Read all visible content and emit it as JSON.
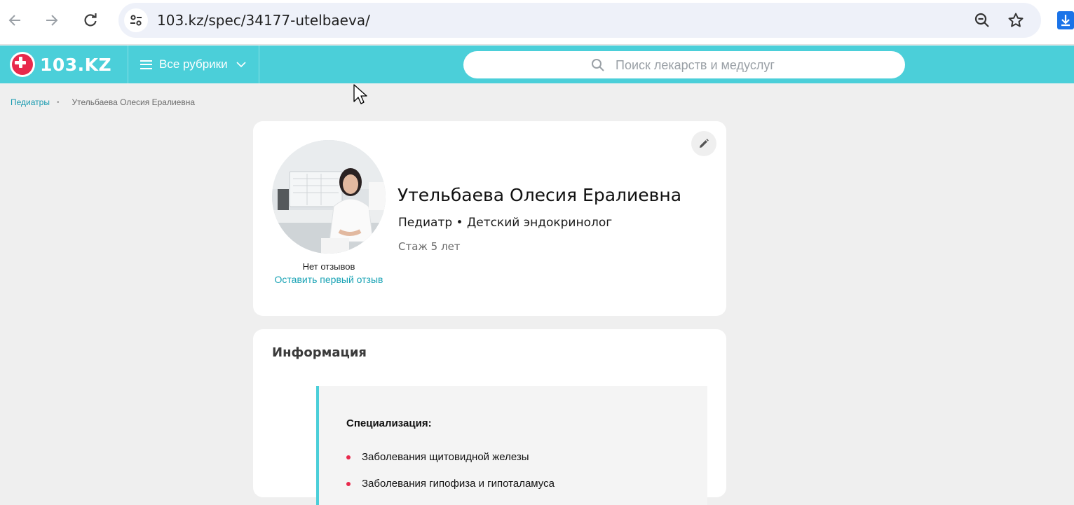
{
  "browser": {
    "url": "103.kz/spec/34177-utelbaeva/",
    "icons": {
      "back": "arrow-left-icon",
      "forward": "arrow-right-icon",
      "reload": "reload-icon",
      "site_info": "tune-icon",
      "zoom": "zoom-out-icon",
      "bookmark": "star-icon",
      "download": "download-icon"
    }
  },
  "header": {
    "logo_text": "103.KZ",
    "rubrics_label": "Все рубрики",
    "search_placeholder": "Поиск лекарств и медуслуг",
    "colors": {
      "header_bg": "#4bcfd9",
      "logo_red": "#e8294c"
    }
  },
  "breadcrumb": {
    "items": [
      "Педиатры",
      "Утельбаева Олесия Ералиевна"
    ]
  },
  "profile": {
    "name": "Утельбаева Олесия Ералиевна",
    "specialties": "Педиатр • Детский эндокринолог",
    "experience": "Стаж 5 лет",
    "reviews_status": "Нет отзывов",
    "first_review_link": "Оставить первый отзыв"
  },
  "info": {
    "title": "Информация",
    "specialization_label": "Специализация:",
    "specialization_items": [
      "Заболевания щитовидной железы",
      "Заболевания гипофиза и гипоталамуса"
    ]
  }
}
